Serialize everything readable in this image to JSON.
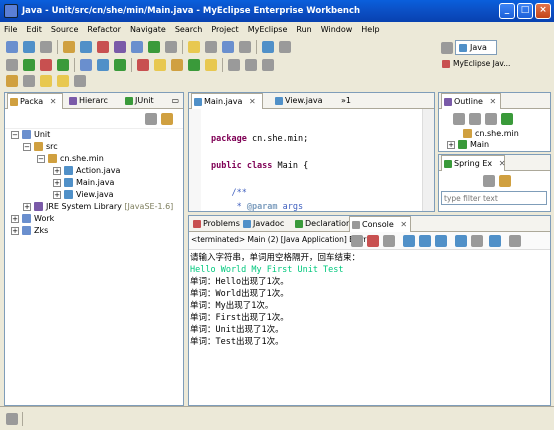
{
  "window": {
    "title": "Java - Unit/src/cn/she/min/Main.java - MyEclipse Enterprise Workbench"
  },
  "menu": [
    "File",
    "Edit",
    "Source",
    "Refactor",
    "Navigate",
    "Search",
    "Project",
    "MyEclipse",
    "Run",
    "Window",
    "Help"
  ],
  "perspective": {
    "current": "Java",
    "other": "MyEclipse Jav..."
  },
  "package_explorer": {
    "tabs": [
      "Packa",
      "Hierarc",
      "JUnit"
    ],
    "tree": [
      {
        "label": "Unit",
        "level": 0,
        "expanded": true
      },
      {
        "label": "src",
        "level": 1,
        "expanded": true
      },
      {
        "label": "cn.she.min",
        "level": 2,
        "expanded": true
      },
      {
        "label": "Action.java",
        "level": 3,
        "expanded": false
      },
      {
        "label": "Main.java",
        "level": 3,
        "expanded": false
      },
      {
        "label": "View.java",
        "level": 3,
        "expanded": false
      },
      {
        "label": "JRE System Library",
        "suffix": "[JavaSE-1.6]",
        "level": 1,
        "expanded": false
      },
      {
        "label": "Work",
        "level": 0,
        "expanded": false
      },
      {
        "label": "Zks",
        "level": 0,
        "expanded": false
      }
    ]
  },
  "editor": {
    "tabs": [
      "Main.java",
      "View.java"
    ],
    "overflow": "»1",
    "lines": [
      {
        "kw": "package",
        "text": " cn.she.min;"
      },
      {
        "kw": "",
        "text": ""
      },
      {
        "kw": "public class",
        "text": " Main {"
      },
      {
        "kw": "",
        "text": ""
      },
      {
        "comment": "    /**"
      },
      {
        "comment": "     * ",
        "tag": "@param",
        "rest": " args"
      },
      {
        "comment": "     */"
      }
    ]
  },
  "outline": {
    "tab": "Outline",
    "items": [
      "cn.she.min",
      "Main"
    ]
  },
  "spring": {
    "tab": "Spring Ex",
    "filter_placeholder": "type filter text"
  },
  "console_panel": {
    "tabs": [
      "Problems",
      "Javadoc",
      "Declaration",
      "Console"
    ],
    "header": "<terminated> Main (2) [Java Application] E:\\Pr",
    "lines": [
      {
        "text": "请输入字符串，单词用空格隔开，回车结束：",
        "type": "output"
      },
      {
        "text": "Hello World My First Unit Test",
        "type": "input"
      },
      {
        "text": "单词：Hello出现了1次。",
        "type": "output"
      },
      {
        "text": "单词：World出现了1次。",
        "type": "output"
      },
      {
        "text": "单词：My出现了1次。",
        "type": "output"
      },
      {
        "text": "单词：First出现了1次。",
        "type": "output"
      },
      {
        "text": "单词：Unit出现了1次。",
        "type": "output"
      },
      {
        "text": "单词：Test出现了1次。",
        "type": "output"
      }
    ]
  }
}
